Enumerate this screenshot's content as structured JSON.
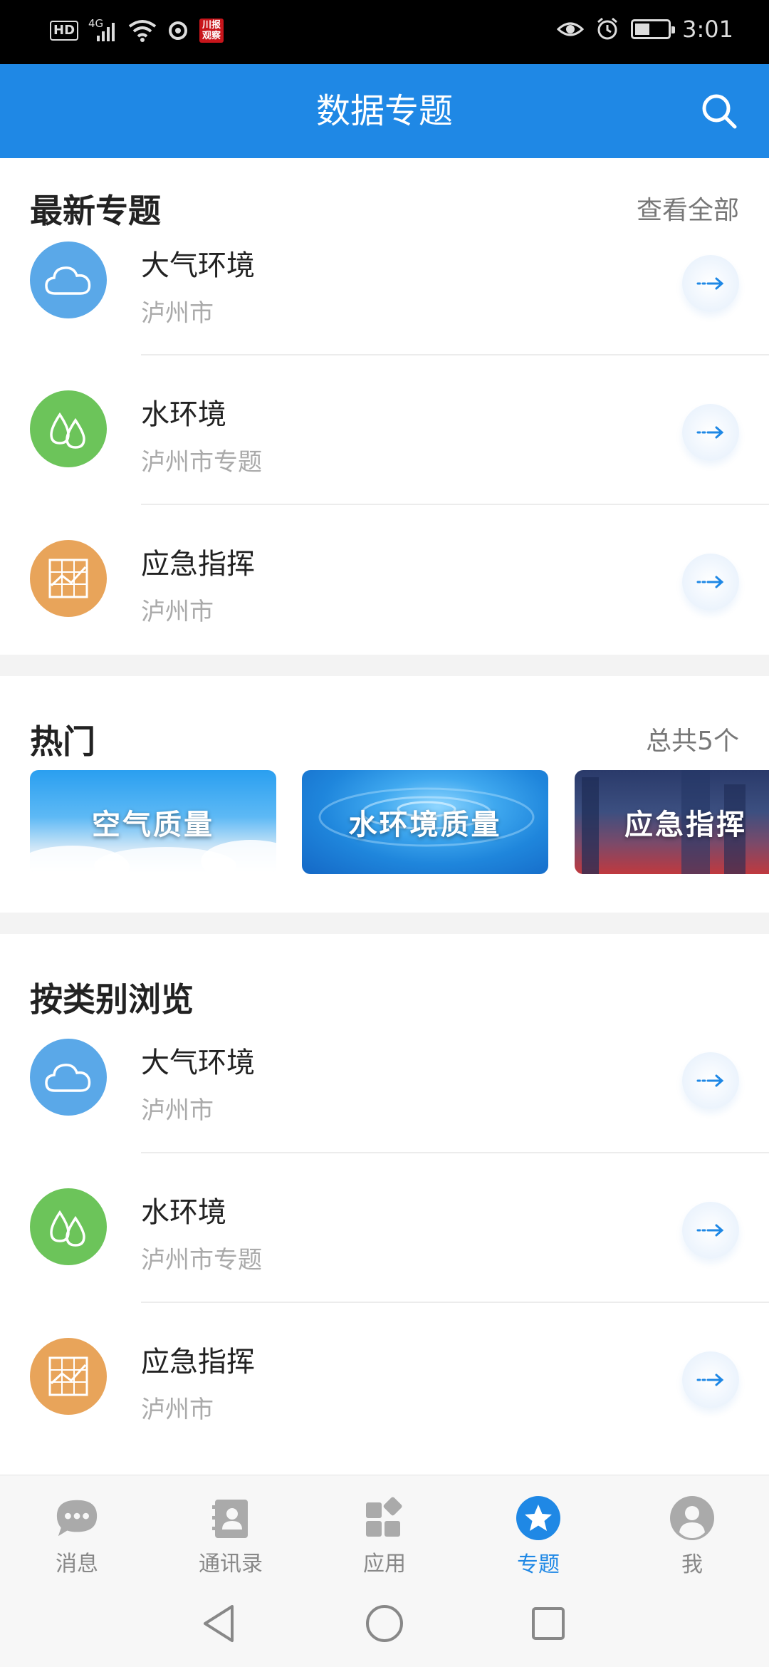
{
  "status_bar": {
    "time": "3:01",
    "hd": "HD",
    "network": "4G",
    "badge_text": "川报观察"
  },
  "header": {
    "title": "数据专题",
    "search_icon": "search-icon"
  },
  "latest": {
    "title": "最新专题",
    "link": "查看全部",
    "items": [
      {
        "title": "大气环境",
        "subtitle": "泸州市",
        "icon": "cloud-icon",
        "color": "#5aa8e8"
      },
      {
        "title": "水环境",
        "subtitle": "泸州市专题",
        "icon": "water-drops-icon",
        "color": "#6cc45a"
      },
      {
        "title": "应急指挥",
        "subtitle": "泸州市",
        "icon": "grid-chart-icon",
        "color": "#e8a45a"
      }
    ]
  },
  "hot": {
    "title": "热门",
    "count": "总共5个",
    "banners": [
      {
        "label": "空气质量"
      },
      {
        "label": "水环境质量"
      },
      {
        "label": "应急指挥"
      }
    ]
  },
  "browse": {
    "title": "按类别浏览",
    "items": [
      {
        "title": "大气环境",
        "subtitle": "泸州市",
        "icon": "cloud-icon",
        "color": "#5aa8e8"
      },
      {
        "title": "水环境",
        "subtitle": "泸州市专题",
        "icon": "water-drops-icon",
        "color": "#6cc45a"
      },
      {
        "title": "应急指挥",
        "subtitle": "泸州市",
        "icon": "grid-chart-icon",
        "color": "#e8a45a"
      }
    ]
  },
  "bottom_nav": {
    "items": [
      {
        "label": "消息",
        "icon": "chat-bubble-icon"
      },
      {
        "label": "通讯录",
        "icon": "contacts-icon"
      },
      {
        "label": "应用",
        "icon": "apps-icon"
      },
      {
        "label": "专题",
        "icon": "star-icon",
        "active": true
      },
      {
        "label": "我",
        "icon": "user-avatar-icon"
      }
    ],
    "active_color": "#1f88e5"
  },
  "colors": {
    "primary": "#1f88e5"
  }
}
